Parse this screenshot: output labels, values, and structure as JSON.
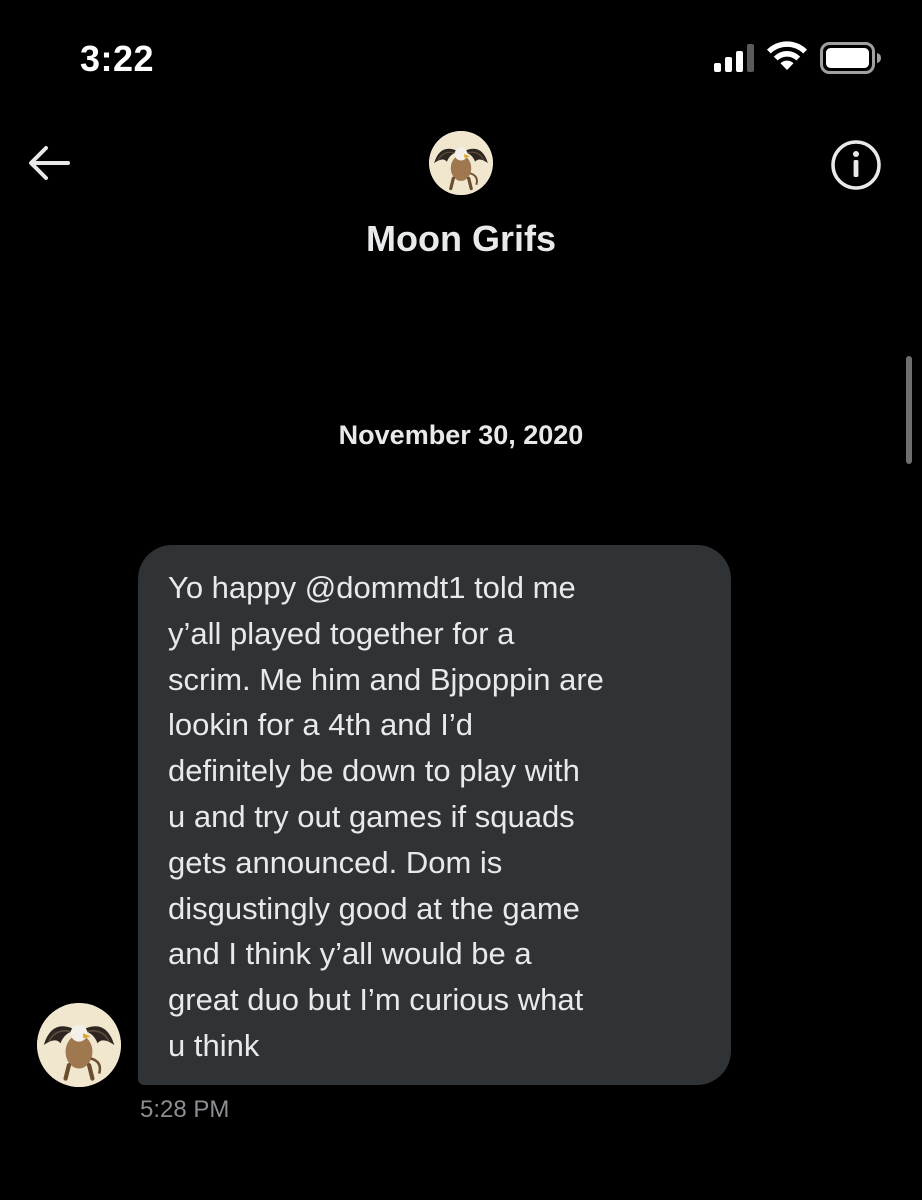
{
  "status_bar": {
    "time": "3:22",
    "icons": [
      "signal-icon",
      "wifi-icon",
      "battery-icon"
    ]
  },
  "header": {
    "back_icon": "back-arrow-icon",
    "info_icon": "info-icon",
    "avatar": "griffin-avatar",
    "name": "Moon Grifs"
  },
  "conversation": {
    "date": "November 30, 2020",
    "messages": [
      {
        "lines": [
          "Yo happy @dommdt1 told me",
          "y’all played together for a",
          "scrim. Me him and Bjpoppin are",
          "lookin for a 4th and I’d",
          "definitely be down to play with",
          "u and try out games if squads",
          "gets announced. Dom is",
          "disgustingly good at the game",
          "and I think y’all would be a",
          "great duo but I’m curious what",
          "u think"
        ],
        "time": "5:28 PM"
      }
    ]
  },
  "colors": {
    "background": "#000000",
    "bubble": "#2f3336",
    "text": "#e7e9ea",
    "muted": "#8b8f93"
  }
}
